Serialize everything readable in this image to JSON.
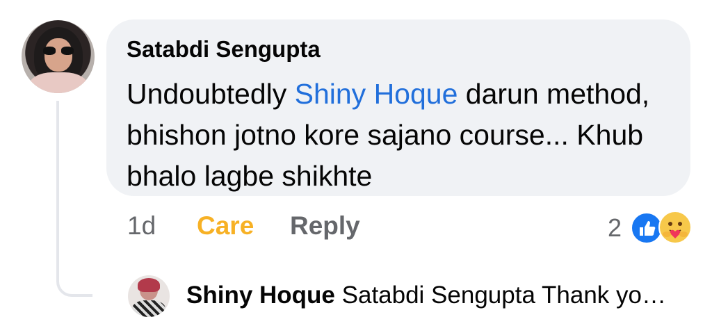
{
  "comment": {
    "author": "Satabdi Sengupta",
    "text_before": "Undoubtedly ",
    "mention": "Shiny Hoque",
    "text_after": "  darun method, bhishon jotno kore sajano course... Khub bhalo lagbe shikhte",
    "time": "1d",
    "reaction_action": "Care",
    "reply_action": "Reply",
    "reaction_count": "2",
    "reactions": [
      "like-icon",
      "care-icon"
    ]
  },
  "reply": {
    "author": "Shiny Hoque",
    "preview": " Satabdi Sengupta Thank yo…"
  },
  "colors": {
    "bubble": "#f0f2f5",
    "mention": "#216fdb",
    "care": "#f7b125",
    "like": "#1877f2",
    "muted": "#65676b"
  }
}
